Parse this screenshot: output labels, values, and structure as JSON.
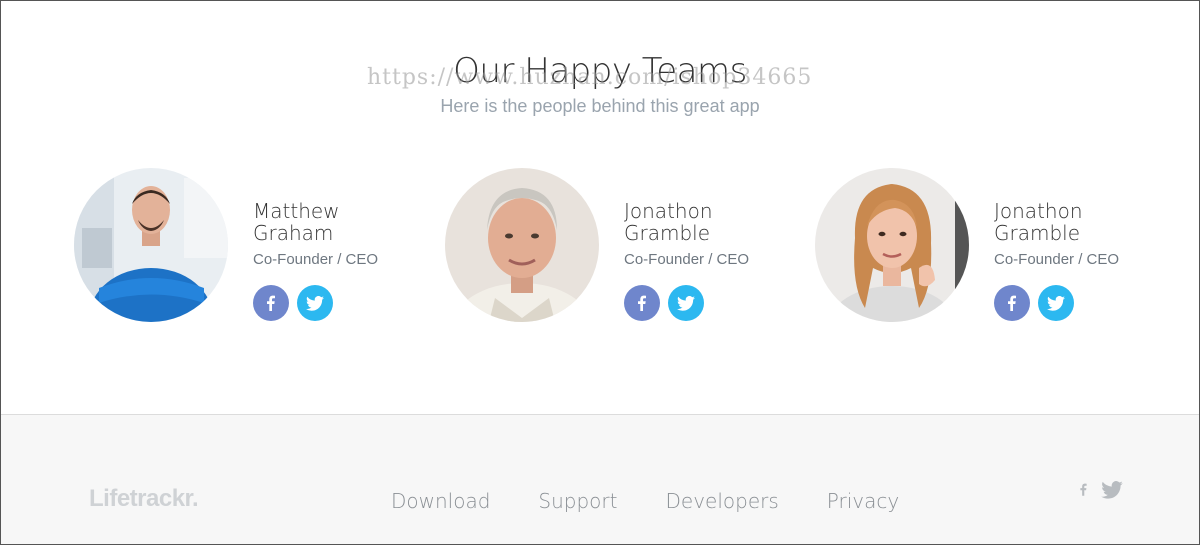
{
  "header": {
    "title": "Our Happy Teams",
    "subtitle": "Here is the people behind this great app",
    "watermark": "https://www.huzhan.com/ishop34665"
  },
  "team": [
    {
      "name": "Matthew Graham",
      "role": "Co-Founder / CEO",
      "avatar_icon": "person-photo-man-blue-shirt",
      "facebook_icon": "facebook-icon",
      "twitter_icon": "twitter-icon"
    },
    {
      "name": "Jonathon Gramble",
      "role": "Co-Founder / CEO",
      "avatar_icon": "person-photo-older-man",
      "facebook_icon": "facebook-icon",
      "twitter_icon": "twitter-icon"
    },
    {
      "name": "Jonathon Gramble",
      "role": "Co-Founder / CEO",
      "avatar_icon": "person-photo-woman",
      "facebook_icon": "facebook-icon",
      "twitter_icon": "twitter-icon"
    }
  ],
  "footer": {
    "logo": "Lifetrackr.",
    "links": [
      "Download",
      "Support",
      "Developers",
      "Privacy"
    ],
    "social_icons": [
      "facebook-icon",
      "twitter-icon"
    ]
  },
  "colors": {
    "facebook": "#6f86cc",
    "twitter": "#2cb8f0",
    "footer_bg": "#f7f7f7",
    "subtitle": "#9aa4ae"
  }
}
